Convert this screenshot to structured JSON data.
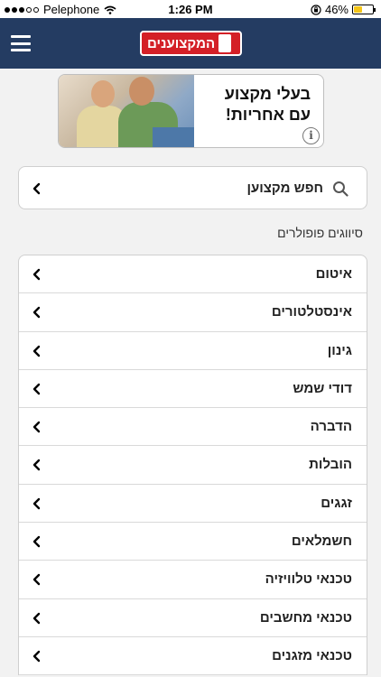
{
  "status_bar": {
    "carrier": "Pelephone",
    "time": "1:26 PM",
    "battery": "46%",
    "battery_level": 0.46,
    "signal_bars_filled": 3,
    "signal_bars_total": 5
  },
  "header": {
    "logo_text": "המקצוענים",
    "background_color": "#243c62",
    "logo_color": "#d42027"
  },
  "banner": {
    "line1": "בעלי מקצוע",
    "line2": "עם אחריות!",
    "info_icon": "info-icon"
  },
  "search": {
    "label": "חפש מקצוען",
    "icon": "search-icon"
  },
  "popular": {
    "title": "סיווגים פופולרים",
    "items": [
      {
        "label": "איטום"
      },
      {
        "label": "אינסטלטורים"
      },
      {
        "label": "גינון"
      },
      {
        "label": "דודי שמש"
      },
      {
        "label": "הדברה"
      },
      {
        "label": "הובלות"
      },
      {
        "label": "זגגים"
      },
      {
        "label": "חשמלאים"
      },
      {
        "label": "טכנאי טלוויזיה"
      },
      {
        "label": "טכנאי מחשבים"
      },
      {
        "label": "טכנאי מזגנים"
      }
    ]
  }
}
